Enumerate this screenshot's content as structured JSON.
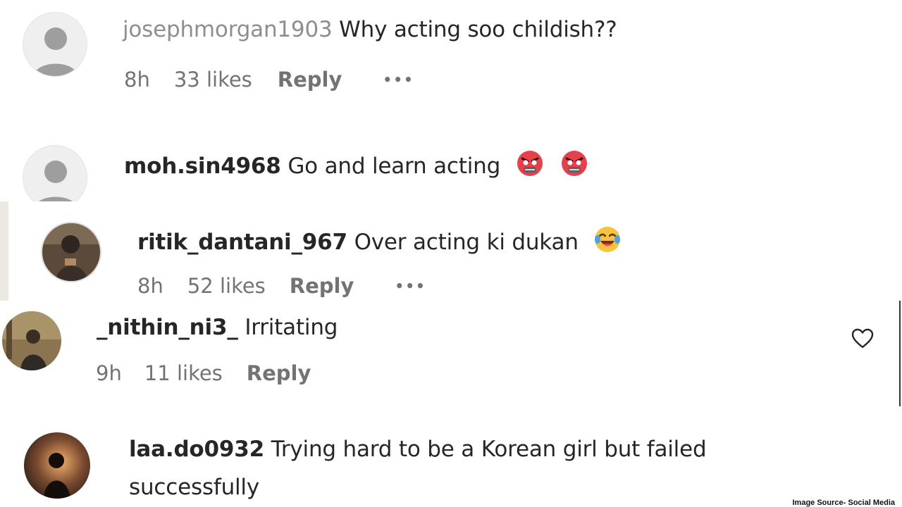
{
  "comments": [
    {
      "username": "josephmorgan1903",
      "text": "Why acting soo childish??",
      "time": "8h",
      "likes": "33 likes",
      "reply": "Reply",
      "more": "•••",
      "avatar": "default-avatar"
    },
    {
      "username": "moh.sin4968",
      "text": "Go and learn acting",
      "emojis": [
        "angry-face-emoji",
        "angry-face-emoji"
      ],
      "avatar": "default-avatar"
    },
    {
      "username": "ritik_dantani_967",
      "text": "Over acting ki dukan",
      "emojis": [
        "laughing-tears-emoji"
      ],
      "time": "8h",
      "likes": "52 likes",
      "reply": "Reply",
      "more": "•••",
      "avatar": "photo-avatar"
    },
    {
      "username": "_nithin_ni3_",
      "text": "Irritating",
      "time": "9h",
      "likes": "11 likes",
      "reply": "Reply",
      "avatar": "photo-avatar",
      "icon": "heart-icon"
    },
    {
      "username": "laa.do0932",
      "text_line1": "Trying hard to be a Korean girl but failed",
      "text_line2": "successfully",
      "avatar": "photo-avatar"
    }
  ],
  "credit": "Image Source- Social Media",
  "colors": {
    "username": "#262626",
    "meta": "#737373",
    "faded_username": "#8e8e8e",
    "divider": "#333333"
  }
}
